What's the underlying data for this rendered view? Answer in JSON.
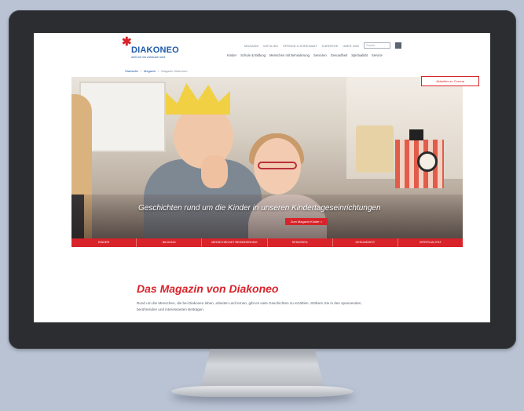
{
  "brand": {
    "name": "DIAKONEO",
    "claim": "weil wir da zuhause sind",
    "accent_color": "#d8232a",
    "logo_color": "#1e5aa8"
  },
  "topnav": {
    "items": [
      "Magazin",
      "Mitglied",
      "Spende & Ehrenamt",
      "Karriere",
      "Über uns"
    ],
    "search_placeholder": "Suche"
  },
  "mainnav": {
    "items": [
      "Kinder",
      "Schule & Bildung",
      "Menschen mit Behinderung",
      "Senioren",
      "Gesundheit",
      "Spiritualität",
      "Service"
    ]
  },
  "breadcrumb": {
    "items": [
      "Startseite",
      "Magazin",
      "Magazin Diakoneo"
    ],
    "separator": "/"
  },
  "aktuelles_label": "Aktuelles zu Corona",
  "hero": {
    "caption": "Geschichten rund um die Kinder in unseren Kindertageseinrichtungen",
    "button_label": "Zum Magazin Kinder >"
  },
  "catnav": {
    "items": [
      "Kinder",
      "Bildung",
      "Menschen mit Behinderung",
      "Senioren",
      "Gesundheit",
      "Spiritualität"
    ]
  },
  "magazine": {
    "title": "Das Magazin von Diakoneo",
    "text": "Rund um die Menschen, die bei Diakoneo leben, arbeiten und lernen, gibt es viele Geschichten zu erzählen. Stöbern Sie in den spannenden, berührenden und interessanten Beiträgen."
  }
}
